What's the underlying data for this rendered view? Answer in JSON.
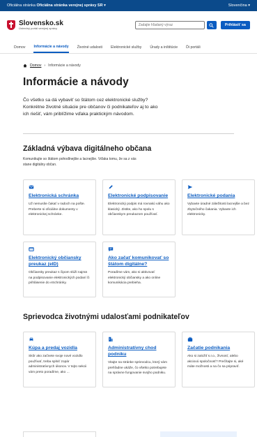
{
  "govbar": {
    "prefix": "Oficiálna stránka",
    "strong": "Oficiálna stránka verejnej správy SR",
    "lang": "Slovenčina"
  },
  "header": {
    "logo_title": "Slovensko.sk",
    "logo_sub": "Ústredný portál verejnej správy",
    "search_placeholder": "Zadajte hľadaný výraz",
    "login_label": "Prihlásiť sa"
  },
  "nav": [
    "Domov",
    "Informácie a návody",
    "Životné udalosti",
    "Elektronické služby",
    "Úrady a inštitúcie",
    "Ďi portáli"
  ],
  "breadcrumb": {
    "home": "Domov",
    "current": "Informácie a návody"
  },
  "page_title": "Informácie a návody",
  "lead": "Čo všetko sa dá vybaviť so štátom cez elektronické služby? Konkrétne životné situácie pre občanov či podnikateľov aj to ako ich riešiť, vám priblížime vďaka praktickým návodom.",
  "section1": {
    "title": "Základná výbava digitálneho občana",
    "subtitle": "Komunikujte so štátom pohodlnejšie a lacnejšie. Vďaka tomu, že sa z vás stane digitálny občan.",
    "cards": [
      {
        "icon": "mailbox-icon",
        "title": "Elektronická schránka",
        "desc": "Už nemusíte čakať v radoch na pošte. Preberte si oficiálne dokumenty v elektronickej schránke."
      },
      {
        "icon": "pen-icon",
        "title": "Elektronické podpisovanie",
        "desc": "Elektronický podpis má rovnakú váhu ako klasický. Zistite, ako ho spolu s občianskym preukazom používať."
      },
      {
        "icon": "send-icon",
        "title": "Elektronické podania",
        "desc": "Vybavte úradné záležitosti lacnejšie a bez zbytočného čakania. Vybavte ich elektronicky."
      },
      {
        "icon": "id-card-icon",
        "title": "Elektronický občiansky preukaz (eID)",
        "desc": "Občiansky preukaz s čipom slúži najmä na podpisovanie elektronických podaní či prihlásenie do eSchránky."
      },
      {
        "icon": "chat-icon",
        "title": "Ako začať komunikovať so štátom digitálne?",
        "desc": "Poradíme vám, ako si aktivovať elektronický občiansky a ako online komunikácia prebieha."
      }
    ]
  },
  "section2": {
    "title": "Sprievodca životnými udalosťami podnikateľov",
    "cards": [
      {
        "icon": "car-icon",
        "title": "Kúpa a predaj vozidla",
        "desc": "Skôr ako začnete svoje nové vozidlo používať, treba splniť zopár administratívnych úkonov. V tejto sekcii vám preto poradíme, ako ..."
      },
      {
        "icon": "building-icon",
        "title": "Administratívny chod podniku",
        "desc": "Vitajte na stránke sprievodcu, ktorý vám prehľadne ukáže, čo všetko potrebujete na správne fungovanie svojho podniku."
      },
      {
        "icon": "briefcase-icon",
        "title": "Začatie podnikania",
        "desc": "Ako si založiť s.r.o., živnosť, alebo akciovú spoločnosť? Prečítajte si, aké máte možnosti a na čo sa pripraviť."
      }
    ]
  },
  "colors": {
    "gov_bar": "#0b4a8b",
    "accent": "#0b5cc1",
    "crest": "#c8102e"
  }
}
